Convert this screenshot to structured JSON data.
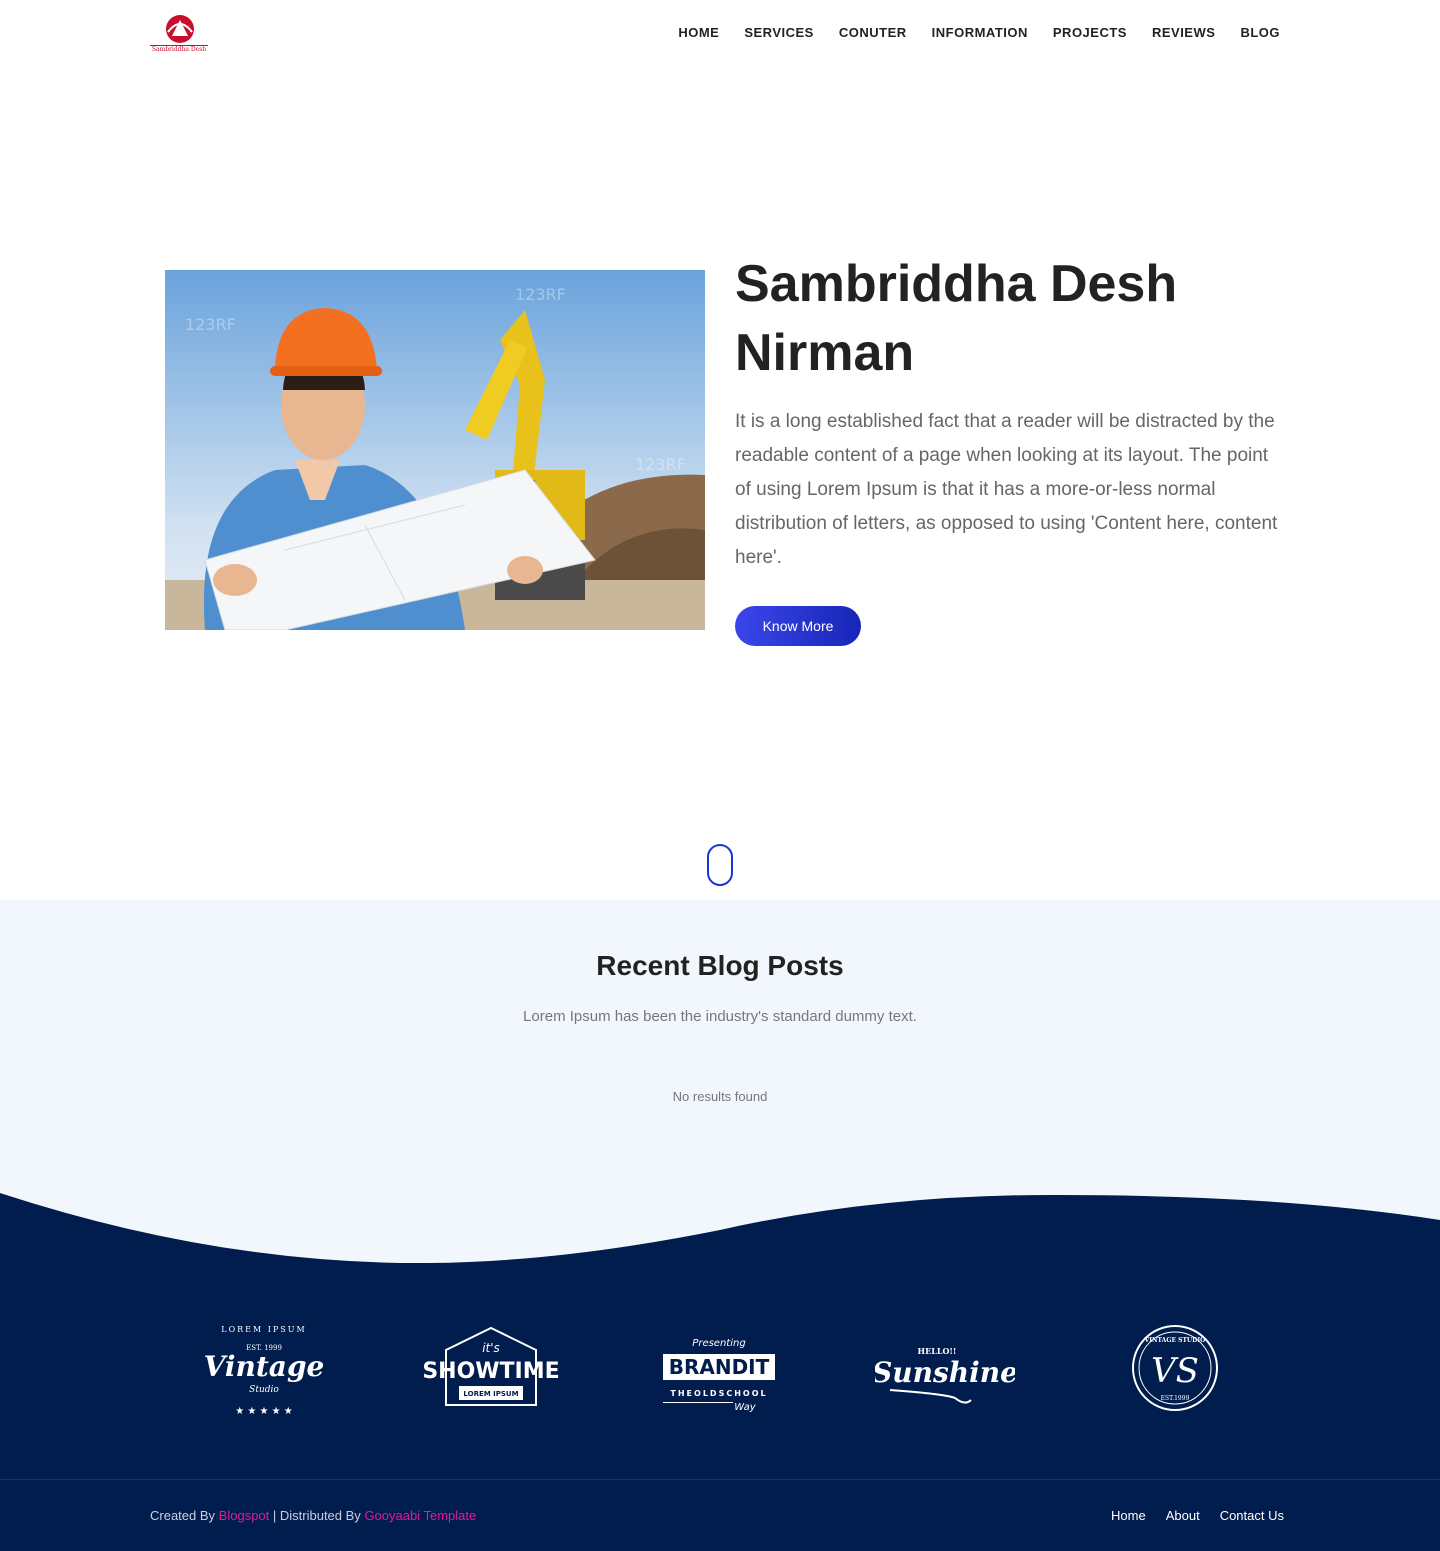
{
  "header": {
    "logo_text": "Sambriddha Desh",
    "nav": [
      "HOME",
      "SERVICES",
      "CONUTER",
      "INFORMATION",
      "PROJECTS",
      "REVIEWS",
      "BLOG"
    ]
  },
  "hero": {
    "title": "Sambriddha Desh Nirman",
    "text": "It is a long established fact that a reader will be distracted by the readable content of a page when looking at its layout. The point of using Lorem Ipsum is that it has a more-or-less normal distribution of letters, as opposed to using 'Content here, content here'.",
    "button": "Know More",
    "image_watermark": "123RF"
  },
  "blog": {
    "title": "Recent Blog Posts",
    "subtitle": "Lorem Ipsum has been the industry's standard dummy text.",
    "empty": "No results found"
  },
  "brands": [
    {
      "top": "LOREM IPSUM",
      "est": "EST. 1999",
      "main": "Vintage",
      "sub": "Studio"
    },
    {
      "top": "it's",
      "main": "SHOWTIME",
      "sub": "LOREM IPSUM"
    },
    {
      "top": "Presenting",
      "main": "BRANDIT",
      "sub": "THEOLDSCHOOL",
      "sub2": "Way"
    },
    {
      "top": "HELLO!!",
      "main": "Sunshine"
    },
    {
      "top": "VINTAGE STUDIO",
      "main": "VS",
      "sub": "EST.1999"
    }
  ],
  "footer": {
    "created_by": "Created By",
    "blogspot": "Blogspot",
    "distributed": "| Distributed By",
    "template": "Gooyaabi Template",
    "links": [
      "Home",
      "About",
      "Contact Us"
    ]
  },
  "colors": {
    "accent": "#2f3ce0",
    "footer_bg": "#011d4d",
    "blog_bg": "#f2f6fd",
    "link_pink": "#e5199a"
  }
}
